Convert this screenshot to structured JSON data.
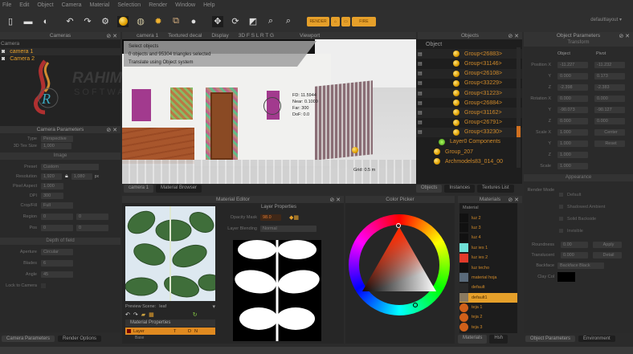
{
  "menu": [
    "File",
    "Edit",
    "Object",
    "Camera",
    "Material",
    "Selection",
    "Render",
    "Window",
    "Help"
  ],
  "toolbar": {
    "icons": [
      "new-file-icon",
      "open-folder-icon",
      "import-icon",
      "undo-icon",
      "redo-icon",
      "settings-icon",
      "sun-light-icon",
      "environment-icon",
      "sunlight-icon",
      "texture-icon",
      "material-sphere-icon",
      "move-icon",
      "rotate-icon",
      "scale-icon",
      "pick-icon",
      "pick-material-icon"
    ],
    "render_label": "RENDER",
    "fire_label": "FIRE",
    "layout": "defaultlayout"
  },
  "cameras": {
    "title": "Cameras",
    "column": "Camera",
    "items": [
      "camera 1",
      "Camera 2"
    ]
  },
  "watermark": {
    "line1": "RAHIM",
    "line2": "SOFTWARE"
  },
  "camera_params": {
    "title": "Camera Parameters",
    "rows": [
      {
        "label": "Type",
        "value": "Perspective"
      },
      {
        "label": "3D Tex Size",
        "value": "1,000"
      }
    ],
    "section_image": "Image",
    "preset_label": "Preset",
    "preset": "Custom",
    "res_label": "Resolution",
    "res_w": "1,920",
    "res_h": "1,080",
    "px": "px",
    "pixel_aspect_label": "Pixel Aspect",
    "pixel_aspect": "1.000",
    "dpi_label": "DPI",
    "dpi": "300",
    "crop_label": "Crop/Fill",
    "crop": "Full",
    "region_label": "Region",
    "region_a": "0",
    "region_b": "0",
    "pos_label": "Pos",
    "pos_a": "0",
    "pos_b": "0",
    "section_dof": "Depth of field",
    "shape_label": "Aperture",
    "shape": "Circular",
    "blades_label": "Blades",
    "blades": "6",
    "angle_label": "Angle",
    "angle": "45",
    "lock_label": "Lock to Camera"
  },
  "left_tabs": [
    "Camera Parameters",
    "Render Options"
  ],
  "viewport": {
    "cam": "camera 1",
    "mode": "Textured decal",
    "display": "Display",
    "views": "3D F S L R T G",
    "title": "Viewport",
    "overlay": [
      "Select objects",
      "0 objects and 95304 triangles selected",
      "Translate using Object system"
    ],
    "hud": [
      "FD: 11.5944",
      "Near: 0.1000",
      "Far: 300",
      "DoF: 0.0"
    ],
    "grid": "Grid: 0.5 m"
  },
  "objects": {
    "title": "Objects",
    "column": "Object",
    "items": [
      "Group<26883>",
      "Group<31146>",
      "Group<26108>",
      "Group<33229>",
      "Group<31223>",
      "Group<26884>",
      "Group<31162>",
      "Group<26791>",
      "Group<33230>"
    ],
    "layer": "Layer0 Components",
    "extra": [
      "Group_207",
      "Archmodels83_014_00"
    ],
    "tabs": [
      "Objects",
      "Instances",
      "Textures List"
    ]
  },
  "obj_params": {
    "title": "Object Parameters",
    "section": "Transform",
    "col_a": "Object",
    "col_b": "Pivot",
    "rows": [
      {
        "label": "Position X",
        "a": "-11.227",
        "b": "-11.232"
      },
      {
        "label": "Y",
        "a": "0.000",
        "b": "0.173"
      },
      {
        "label": "Z",
        "a": "-2.398",
        "b": "-2.383"
      },
      {
        "label": "Rotation X",
        "a": "0.000",
        "b": "0.000"
      },
      {
        "label": "Y",
        "a": "-90.073",
        "b": "-90.127"
      },
      {
        "label": "Z",
        "a": "0.000",
        "b": "0.000"
      },
      {
        "label": "Scale X",
        "a": "1.000",
        "btn": "Center"
      },
      {
        "label": "Y",
        "a": "1.000",
        "btn": "Reset"
      },
      {
        "label": "Z",
        "a": "1.000"
      },
      {
        "label": "Scale",
        "a": "1.000"
      }
    ],
    "section2": "Appearance",
    "render_mode_label": "Render Mode",
    "render_modes": [
      "Default",
      "Shadowed Ambient",
      "Solid Backside",
      "Invisible"
    ],
    "roundness_label": "Roundness",
    "roundness": "0.00",
    "apply_label": "Apply",
    "transform_label": "Translucent",
    "transform": "0.000",
    "detail_label": "Detail",
    "backface_label": "Backface",
    "backface": "Backface Black",
    "color_label": "Clay Col",
    "tabs": [
      "Object Parameters",
      "Environment"
    ]
  },
  "mid_tabs": [
    "camera 1",
    "Material Browser"
  ],
  "material_editor": {
    "title": "Material Editor",
    "layer_props": "Layer Properties",
    "opacity_label": "Opacity Mask",
    "opacity": "98.0",
    "blending_label": "Layer Blending",
    "blending": "Normal",
    "preview_label": "Preview Scene:",
    "preview": "leaf",
    "mat_props": "Material Properties",
    "layer_row": "Layer",
    "layer_cols": [
      "T",
      "D",
      "N"
    ],
    "sub_row": "Base"
  },
  "color_picker": {
    "title": "Color Picker"
  },
  "materials": {
    "title": "Materials",
    "column": "Material",
    "items": [
      {
        "name": "luz 2",
        "color": "#111"
      },
      {
        "name": "luz 3",
        "color": "#111"
      },
      {
        "name": "luz 4",
        "color": "#111"
      },
      {
        "name": "luz ies 1",
        "color": "#6fe0d6"
      },
      {
        "name": "luz ies 2",
        "color": "#e23a2a"
      },
      {
        "name": "luz techo",
        "color": "#111"
      },
      {
        "name": "material hoja",
        "color": "#5a6a7a"
      },
      {
        "name": "default",
        "color": "#2a2a2a"
      },
      {
        "name": "default1",
        "color": "#8a7a60"
      },
      {
        "name": "teja 1",
        "color": "#d0601a"
      },
      {
        "name": "teja 2",
        "color": "#d0601a"
      },
      {
        "name": "teja 3",
        "color": "#d0601a"
      }
    ],
    "selected": "default1",
    "tabs": [
      "Materials",
      "Hsh"
    ]
  },
  "colors": {
    "accent": "#e6a02a",
    "panel": "#2a2a2a"
  }
}
